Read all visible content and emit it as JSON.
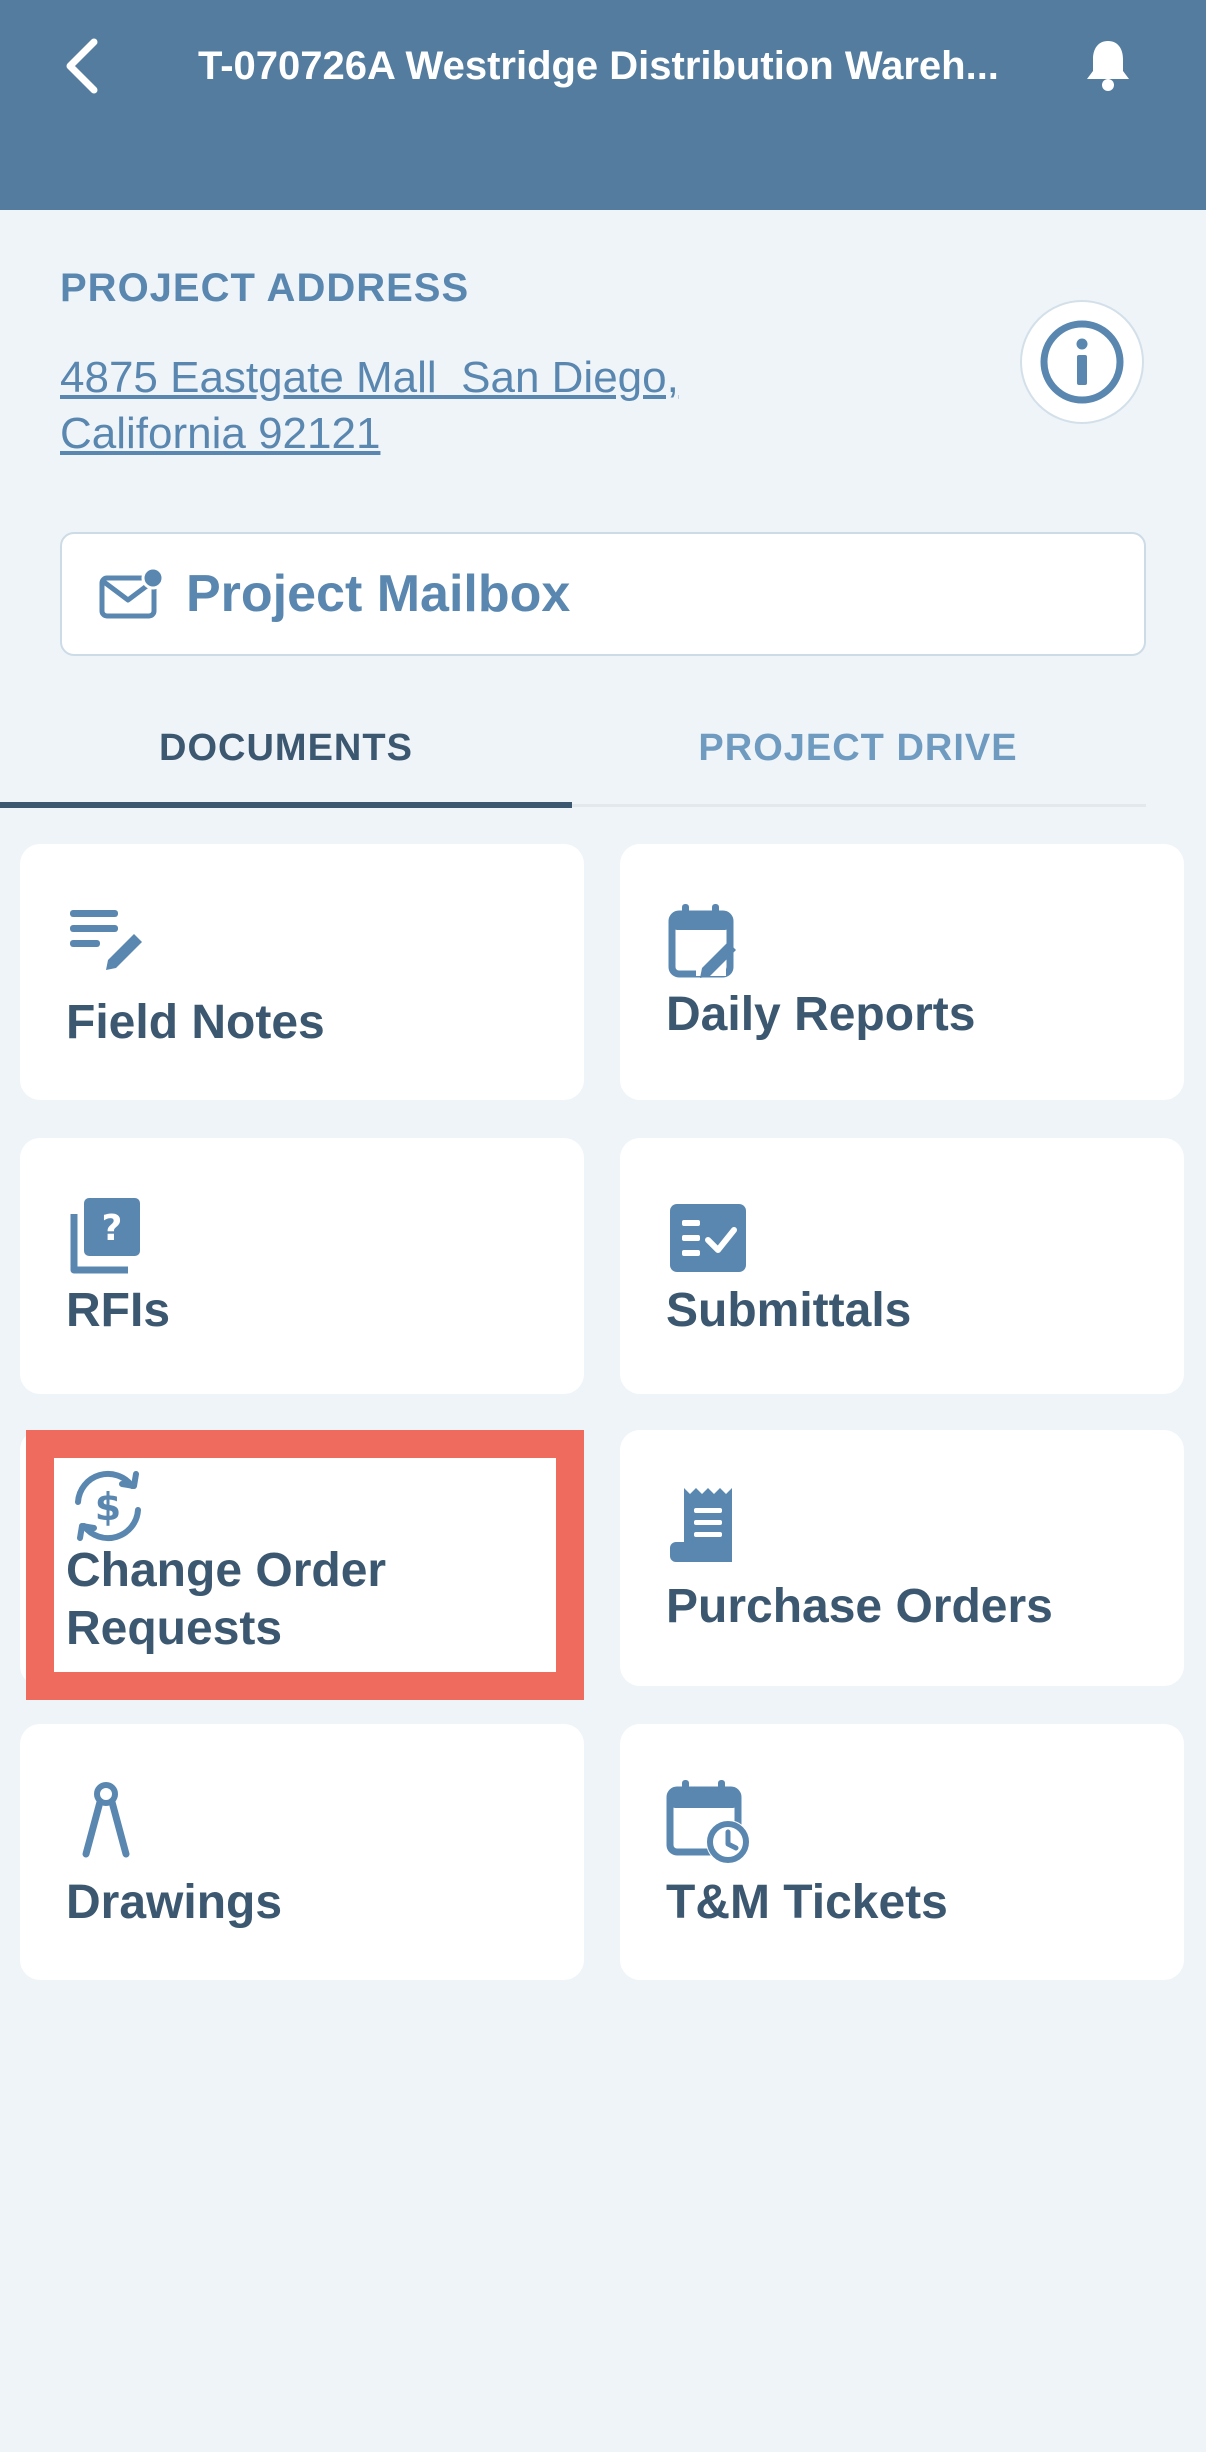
{
  "header": {
    "title": "T-070726A Westridge Distribution Wareh...",
    "back_icon": "chevron-left-icon",
    "bell_icon": "bell-icon"
  },
  "address": {
    "heading": "PROJECT ADDRESS",
    "line1": "4875 Eastgate Mall  San Diego,",
    "line2": "California 92121",
    "info_icon": "info-icon"
  },
  "mailbox": {
    "label": "Project Mailbox",
    "icon": "mail-notification-icon"
  },
  "tabs": [
    {
      "label": "DOCUMENTS",
      "active": true
    },
    {
      "label": "PROJECT DRIVE",
      "active": false
    }
  ],
  "tiles": [
    {
      "label": "Field Notes",
      "icon": "notes-edit-icon"
    },
    {
      "label": "Daily Reports",
      "icon": "calendar-edit-icon"
    },
    {
      "label": "RFIs",
      "icon": "question-document-icon"
    },
    {
      "label": "Submittals",
      "icon": "checklist-icon"
    },
    {
      "label": "Change Order\nRequests",
      "line1": "Change Order",
      "line2": "Requests",
      "icon": "dollar-sync-icon",
      "highlighted": true
    },
    {
      "label": "Purchase Orders",
      "icon": "receipt-icon"
    },
    {
      "label": "Drawings",
      "icon": "compass-icon"
    },
    {
      "label": "T&M Tickets",
      "icon": "calendar-clock-icon"
    }
  ],
  "colors": {
    "header_bg": "#537c9e",
    "accent": "#5a87b0",
    "text_dark": "#3c5870",
    "page_bg": "#eff4f8",
    "highlight": "#ee6b5d"
  }
}
